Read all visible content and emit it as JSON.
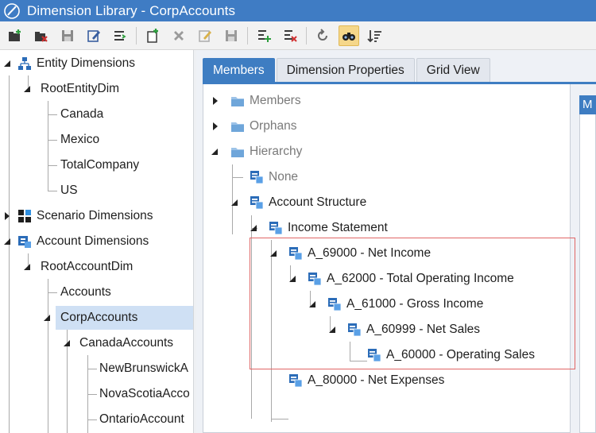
{
  "window": {
    "title": "Dimension Library - CorpAccounts"
  },
  "toolbar": {
    "buttons": [
      "create-dimension-icon",
      "delete-dimension-icon",
      "save-dimension-icon",
      "edit-dimension-icon",
      "dimension-properties-icon",
      "create-member-icon",
      "delete-member-icon",
      "edit-member-icon",
      "save-member-icon",
      "add-relationship-icon",
      "remove-relationship-icon",
      "refresh-icon",
      "search-icon",
      "sort-icon"
    ],
    "active": "search-icon"
  },
  "left_tree": {
    "entity_dimensions": "Entity Dimensions",
    "root_entity_dim": "RootEntityDim",
    "canada": "Canada",
    "mexico": "Mexico",
    "total_company": "TotalCompany",
    "us": "US",
    "scenario_dimensions": "Scenario Dimensions",
    "account_dimensions": "Account Dimensions",
    "root_account_dim": "RootAccountDim",
    "accounts": "Accounts",
    "corp_accounts": "CorpAccounts",
    "canada_accounts": "CanadaAccounts",
    "new_brunswick": "NewBrunswickA",
    "nova_scotia": "NovaScotiaAcco",
    "ontario": "OntarioAccount"
  },
  "tabs": {
    "members": "Members",
    "dimension_properties": "Dimension Properties",
    "grid_view": "Grid View"
  },
  "side_stub_tab": "M",
  "member_tree": {
    "members_folder": "Members",
    "orphans_folder": "Orphans",
    "hierarchy_folder": "Hierarchy",
    "none": "None",
    "account_structure": "Account Structure",
    "income_statement": "Income Statement",
    "net_income": "A_69000 - Net Income",
    "total_operating_income": "A_62000 - Total Operating Income",
    "gross_income": "A_61000 - Gross Income",
    "net_sales": "A_60999 - Net Sales",
    "operating_sales": "A_60000 - Operating Sales",
    "net_expenses": "A_80000 - Net Expenses"
  },
  "colors": {
    "titlebar": "#3f7cc4",
    "tab_active": "#3e7dc2",
    "selection": "#cfe0f4",
    "highlight_box": "#e06666"
  }
}
